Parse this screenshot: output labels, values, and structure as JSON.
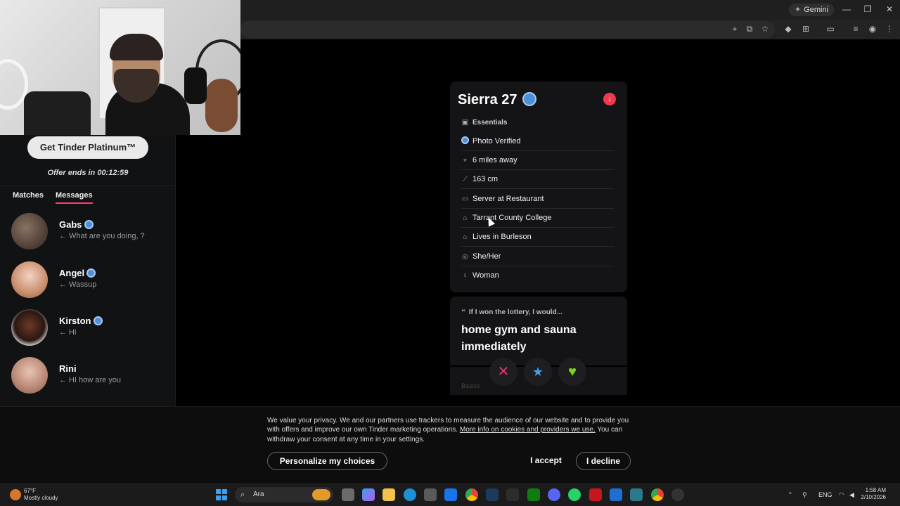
{
  "browser": {
    "gemini_label": "Gemini"
  },
  "left_panel": {
    "platinum_button": "Get Tinder Platinum™",
    "offer_text": "Offer ends in 00:12:59",
    "tabs": [
      {
        "label": "Matches",
        "active": false
      },
      {
        "label": "Messages",
        "active": true
      }
    ],
    "messages": [
      {
        "name": "Gabs",
        "verified": true,
        "preview": "← What are you doing, ?"
      },
      {
        "name": "Angel",
        "verified": true,
        "preview": "← Wassup"
      },
      {
        "name": "Kirston",
        "verified": true,
        "preview": "← Hi"
      },
      {
        "name": "Rini",
        "verified": false,
        "preview": "← HI how are you"
      }
    ]
  },
  "profile": {
    "name_age": "Sierra 27",
    "section_title": "Essentials",
    "essentials": [
      {
        "icon": "verified-icon",
        "text": "Photo Verified"
      },
      {
        "icon": "location-pin-icon",
        "text": "6 miles away"
      },
      {
        "icon": "ruler-icon",
        "text": "163 cm"
      },
      {
        "icon": "briefcase-icon",
        "text": "Server at Restaurant"
      },
      {
        "icon": "graduation-cap-icon",
        "text": "Tarrant County College"
      },
      {
        "icon": "home-icon",
        "text": "Lives in Burleson"
      },
      {
        "icon": "pronouns-icon",
        "text": "She/Her"
      },
      {
        "icon": "person-icon",
        "text": "Woman"
      }
    ],
    "prompt_label": "If I won the lottery, I would...",
    "prompt_answer": "home gym and sauna immediately",
    "basics_label": "Basics",
    "actions": {
      "nope": "✕",
      "super_like": "★",
      "like": "♥"
    },
    "colors": {
      "nope": "#e8336f",
      "super_like": "#3aa0f0",
      "like": "#7ed321",
      "accent": "#fd3a73"
    }
  },
  "cookie_banner": {
    "text_before": "We value your privacy. We and our partners use trackers to measure the audience of our website and to provide you with offers and improve our own Tinder marketing operations.",
    "link": "More info on cookies and providers we use.",
    "text_after": "You can withdraw your consent at any time in your settings.",
    "personalize_button": "Personalize my choices",
    "accept_button": "I accept",
    "decline_button": "I decline"
  },
  "taskbar": {
    "weather_temp": "67°F",
    "weather_desc": "Mostly cloudy",
    "search_text": "Ara",
    "language": "ENG",
    "time": "1:58 AM",
    "date": "2/10/2026"
  }
}
